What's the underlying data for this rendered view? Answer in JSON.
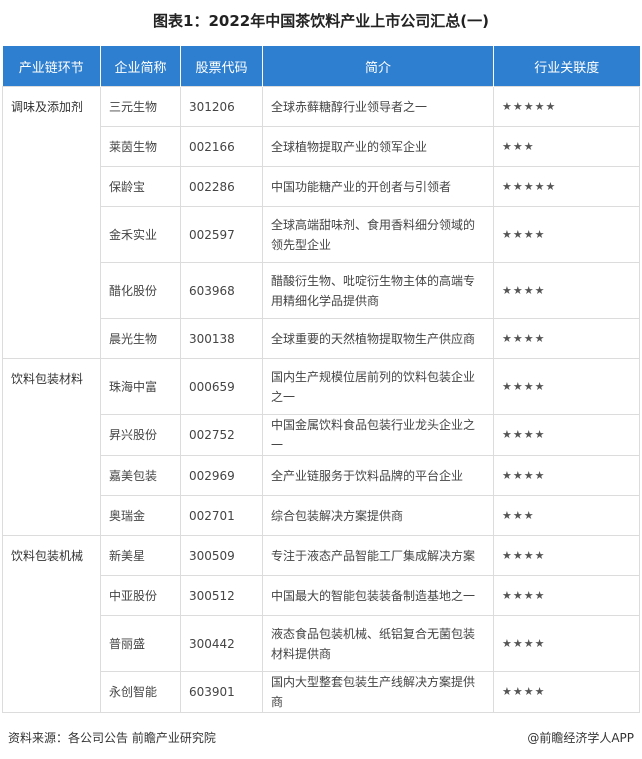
{
  "title": "图表1：2022年中国茶饮料产业上市公司汇总(一)",
  "columns": [
    "产业链环节",
    "企业简称",
    "股票代码",
    "简介",
    "行业关联度"
  ],
  "categories": [
    {
      "name": "调味及添加剂",
      "rows": [
        {
          "company": "三元生物",
          "code": "301206",
          "intro": "全球赤藓糖醇行业领导者之一",
          "rating": "★★★★★"
        },
        {
          "company": "莱茵生物",
          "code": "002166",
          "intro": "全球植物提取产业的领军企业",
          "rating": "★★★"
        },
        {
          "company": "保龄宝",
          "code": "002286",
          "intro": "中国功能糖产业的开创者与引领者",
          "rating": "★★★★★"
        },
        {
          "company": "金禾实业",
          "code": "002597",
          "intro": "全球高端甜味剂、食用香料细分领域的领先型企业",
          "rating": "★★★★"
        },
        {
          "company": "醋化股份",
          "code": "603968",
          "intro": "醋酸衍生物、吡啶衍生物主体的高端专用精细化学品提供商",
          "rating": "★★★★"
        },
        {
          "company": "晨光生物",
          "code": "300138",
          "intro": "全球重要的天然植物提取物生产供应商",
          "rating": "★★★★"
        }
      ]
    },
    {
      "name": "饮料包装材料",
      "rows": [
        {
          "company": "珠海中富",
          "code": "000659",
          "intro": "国内生产规模位居前列的饮料包装企业之一",
          "rating": "★★★★"
        },
        {
          "company": "昇兴股份",
          "code": "002752",
          "intro": "中国金属饮料食品包装行业龙头企业之一",
          "rating": "★★★★"
        },
        {
          "company": "嘉美包装",
          "code": "002969",
          "intro": "全产业链服务于饮料品牌的平台企业",
          "rating": "★★★★"
        },
        {
          "company": "奥瑞金",
          "code": "002701",
          "intro": "综合包装解决方案提供商",
          "rating": "★★★"
        }
      ]
    },
    {
      "name": "饮料包装机械",
      "rows": [
        {
          "company": "新美星",
          "code": "300509",
          "intro": "专注于液态产品智能工厂集成解决方案",
          "rating": "★★★★"
        },
        {
          "company": "中亚股份",
          "code": "300512",
          "intro": "中国最大的智能包装装备制造基地之一",
          "rating": "★★★★"
        },
        {
          "company": "普丽盛",
          "code": "300442",
          "intro": "液态食品包装机械、纸铝复合无菌包装材料提供商",
          "rating": "★★★★"
        },
        {
          "company": "永创智能",
          "code": "603901",
          "intro": "国内大型整套包装生产线解决方案提供商",
          "rating": "★★★★"
        }
      ]
    }
  ],
  "footer": {
    "source": "资料来源：各公司公告 前瞻产业研究院",
    "brand": "@前瞻经济学人APP"
  }
}
